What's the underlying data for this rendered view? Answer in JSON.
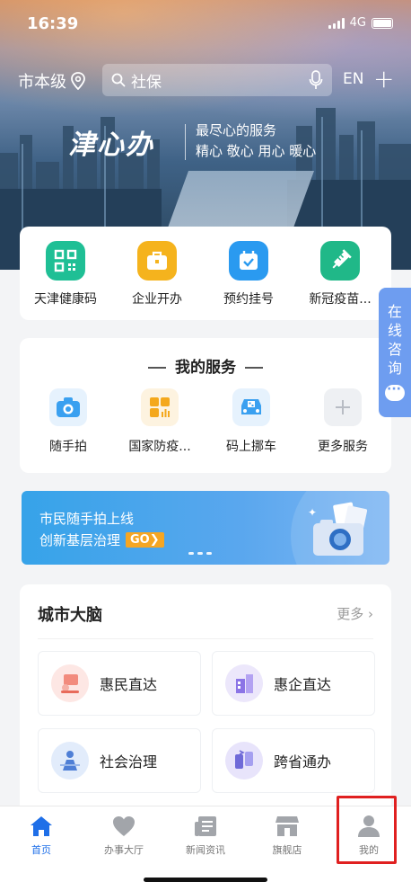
{
  "status_bar": {
    "time": "16:39",
    "network": "4G"
  },
  "top_bar": {
    "city": "市本级",
    "search_placeholder": "社保",
    "language": "EN"
  },
  "hero": {
    "brand": "津心办",
    "slogan_line1": "最尽心的服务",
    "slogan_line2": "精心  敬心  用心  暖心"
  },
  "quick_links": [
    {
      "label": "天津健康码",
      "icon": "qr-code-icon",
      "color": "#1fbf95"
    },
    {
      "label": "企业开办",
      "icon": "briefcase-icon",
      "color": "#f5b31d"
    },
    {
      "label": "预约挂号",
      "icon": "calendar-check-icon",
      "color": "#2a9af0"
    },
    {
      "label": "新冠疫苗...",
      "icon": "syringe-icon",
      "color": "#20b888"
    }
  ],
  "my_services": {
    "title": "我的服务",
    "items": [
      {
        "label": "随手拍",
        "icon": "camera-icon",
        "color": "#3aa0f0"
      },
      {
        "label": "国家防疫...",
        "icon": "grid-chart-icon",
        "color": "#f4a81c"
      },
      {
        "label": "码上挪车",
        "icon": "car-qr-icon",
        "color": "#3aa0f0"
      },
      {
        "label": "更多服务",
        "icon": "plus-icon",
        "color": "#c9ccd2"
      }
    ]
  },
  "side_tab": {
    "label": "在线咨询"
  },
  "banner": {
    "line1": "市民随手拍上线",
    "line2": "创新基层治理",
    "go": "GO❯"
  },
  "city_brain": {
    "title": "城市大脑",
    "more": "更多",
    "tiles": [
      {
        "label": "惠民直达",
        "icon": "people-service-icon"
      },
      {
        "label": "惠企直达",
        "icon": "enterprise-icon"
      },
      {
        "label": "社会治理",
        "icon": "governance-icon"
      },
      {
        "label": "跨省通办",
        "icon": "cross-province-icon"
      }
    ]
  },
  "tabbar": {
    "items": [
      {
        "label": "首页",
        "icon": "home-icon",
        "active": true
      },
      {
        "label": "办事大厅",
        "icon": "heart-icon",
        "active": false
      },
      {
        "label": "新闻资讯",
        "icon": "news-icon",
        "active": false
      },
      {
        "label": "旗舰店",
        "icon": "store-icon",
        "active": false
      },
      {
        "label": "我的",
        "icon": "person-icon",
        "active": false
      }
    ]
  },
  "colors": {
    "primary": "#1f6fe8",
    "highlight": "#e02020"
  }
}
